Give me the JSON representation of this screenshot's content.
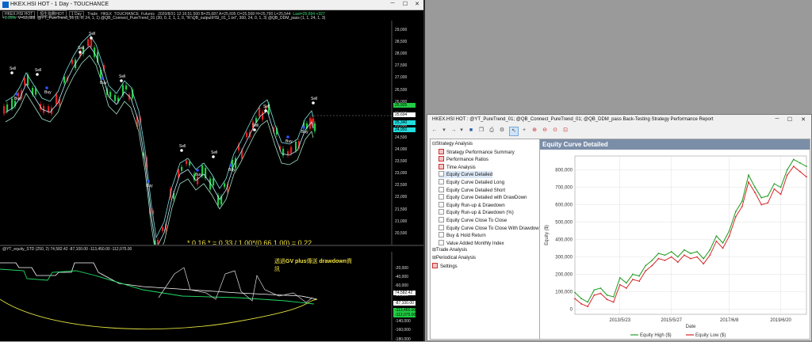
{
  "main_window": {
    "title": "HKEX.HSI HOT - 1 Day - TOUCHANCE",
    "minimize_icon": "─",
    "maximize_icon": "☐",
    "close_icon": "✕"
  },
  "quote_header": {
    "boxes": [
      "HKEX.HSI HOT",
      "恒生指數HOT",
      "1 Day"
    ],
    "trade_label": "Trade",
    "exchange": "HKEX",
    "source": "TOUCHANCE",
    "kind": "Futures",
    "ohlc": "2020/8/31  12:16:51.500  B=25,687  A=25,695  O=25,568  H=25,790  L=25,544",
    "last": "Last=25,694  +327",
    "change_pct": "+1.29%",
    "volume": "V=53,089",
    "indicators": "@YT_PureTrend_01 (1, 0, 24, 1, 1)   @QB_Connect_PureTrend_01 (30, 0, 2, 1, 1, 0, \"R:\\QB_output\\HSI_01_1.txt\", 360, 24, 0, 1, 3)   @QB_DDM_pass (1, 1, 24, 1, 3)"
  },
  "price_axis": {
    "labels": [
      "29,000",
      "28,500",
      "28,000",
      "27,500",
      "27,000",
      "26,500",
      "26,000",
      "25,500",
      "25,000",
      "24,500",
      "24,000",
      "23,500",
      "23,000",
      "22,500",
      "22,000",
      "21,500",
      "21,000",
      "20,500"
    ],
    "badges": [
      {
        "text": "25,925",
        "color": "#22cc44"
      },
      {
        "text": "25,694",
        "color": "#ffffff"
      },
      {
        "text": "25,340",
        "color": "#22dddd"
      },
      {
        "text": "24,950",
        "color": "#22dddd"
      }
    ]
  },
  "signals": {
    "sell": "Sell",
    "buy": "Buy"
  },
  "formula": "* 0.16 *     = 0.33 / 1.00*(0.66,1.00) = 0.22",
  "sub_panel": {
    "header": "@YT_equity_STD  (250, 2)  74,582.42  -87,100.00  -113,450.00  -112,075.00",
    "axis_labels": [
      "-20,000",
      "-40,000",
      "-60,000",
      "-80,000",
      "-100,000",
      "-120,000",
      "-140,000",
      "-160,000",
      "-180,000"
    ],
    "badges": [
      {
        "text": "74,582.42",
        "color": "#ffffff"
      },
      {
        "text": "-87,100.00",
        "color": "#ffffff"
      },
      {
        "text": "-113,450.00",
        "color": "#22cc44"
      },
      {
        "text": "-112,075.00",
        "color": "#22cc44"
      }
    ],
    "note_line1_a": "透過",
    "note_line1_b": "GV plus",
    "note_line1_c": "傳送 ",
    "note_line1_d": "drawdown",
    "note_line1_e": "資",
    "note_line2": "訊"
  },
  "report_window": {
    "title": "HKEX.HSI HOT : @YT_PureTrend_01; @QB_Connect_PureTrend_01; @QB_DDM_pass Back-Testing Strategy Performance Report",
    "minimize_icon": "─",
    "maximize_icon": "☐",
    "close_icon": "✕",
    "toolbar_icons": [
      "back-arrow",
      "forward-arrow",
      "save",
      "copy",
      "print",
      "settings",
      "cursor",
      "crosshair",
      "zoom-in",
      "zoom-out",
      "zoom-reset",
      "zoom-area"
    ],
    "tree": [
      {
        "label": "Strategy Analysis",
        "level": 0,
        "toggle": "⊟"
      },
      {
        "label": "Strategy Performance Summary",
        "level": 1,
        "red": true
      },
      {
        "label": "Performance Ratios",
        "level": 1,
        "red": true
      },
      {
        "label": "Time Analysis",
        "level": 1,
        "red": true
      },
      {
        "label": "Equity Curve Detailed",
        "level": 1,
        "selected": true
      },
      {
        "label": "Equity Curve Detailed Long",
        "level": 1
      },
      {
        "label": "Equity Curve Detailed Short",
        "level": 1
      },
      {
        "label": "Equity Curve Detailed with DrawDown",
        "level": 1
      },
      {
        "label": "Equity Run-up & Drawdown",
        "level": 1
      },
      {
        "label": "Equity Run-up & Drawdown (%)",
        "level": 1
      },
      {
        "label": "Equity Curve Close To Close",
        "level": 1
      },
      {
        "label": "Equity Curve Close To Close With Drawdown",
        "level": 1
      },
      {
        "label": "Buy & Hold Return",
        "level": 1
      },
      {
        "label": "Value Added Monthly Index",
        "level": 1
      },
      {
        "label": "Trade Analysis",
        "level": 0,
        "toggle": "⊞"
      },
      {
        "label": "Periodical Analysis",
        "level": 0,
        "toggle": "⊞"
      },
      {
        "label": "Settings",
        "level": 0,
        "red": true
      }
    ],
    "panel_title": "Equity Curve Detailed"
  },
  "chart_data": {
    "type": "line",
    "title": "Equity Curve Detailed",
    "xlabel": "Date",
    "ylabel": "Equity ($)",
    "x_ticks": [
      "2013/5/23",
      "2015/5/27",
      "2017/6/8",
      "2019/6/20"
    ],
    "y_ticks": [
      0,
      100000,
      200000,
      300000,
      400000,
      500000,
      600000,
      700000,
      800000
    ],
    "y_tick_labels": [
      "0",
      "100,000",
      "200,000",
      "300,000",
      "400,000",
      "500,000",
      "600,000",
      "700,000",
      "800,000"
    ],
    "ylim": [
      -30000,
      880000
    ],
    "grid": true,
    "legend_position": "bottom",
    "x_dates": [
      "2011/7",
      "2011/10",
      "2012/1",
      "2012/4",
      "2012/7",
      "2012/10",
      "2013/1",
      "2013/4",
      "2013/7",
      "2013/10",
      "2014/1",
      "2014/4",
      "2014/7",
      "2014/10",
      "2015/1",
      "2015/4",
      "2015/7",
      "2015/10",
      "2016/1",
      "2016/4",
      "2016/7",
      "2016/10",
      "2017/1",
      "2017/4",
      "2017/7",
      "2017/10",
      "2018/1",
      "2018/4",
      "2018/7",
      "2018/10",
      "2019/1",
      "2019/4",
      "2019/7",
      "2019/10",
      "2020/1",
      "2020/4",
      "2020/7"
    ],
    "series": [
      {
        "name": "Equity High ($)",
        "color": "#2ca02c",
        "values": [
          95000,
          60000,
          40000,
          110000,
          120000,
          80000,
          70000,
          180000,
          150000,
          200000,
          190000,
          250000,
          280000,
          320000,
          310000,
          330000,
          300000,
          340000,
          320000,
          330000,
          290000,
          340000,
          420000,
          380000,
          450000,
          560000,
          620000,
          770000,
          700000,
          640000,
          650000,
          720000,
          700000,
          800000,
          860000,
          840000,
          820000
        ]
      },
      {
        "name": "Equity Low ($)",
        "color": "#d62728",
        "values": [
          60000,
          30000,
          15000,
          80000,
          90000,
          55000,
          40000,
          140000,
          120000,
          170000,
          160000,
          220000,
          250000,
          290000,
          280000,
          300000,
          270000,
          310000,
          290000,
          300000,
          260000,
          310000,
          390000,
          350000,
          420000,
          530000,
          590000,
          730000,
          670000,
          600000,
          610000,
          690000,
          660000,
          770000,
          820000,
          790000,
          760000
        ]
      }
    ]
  }
}
